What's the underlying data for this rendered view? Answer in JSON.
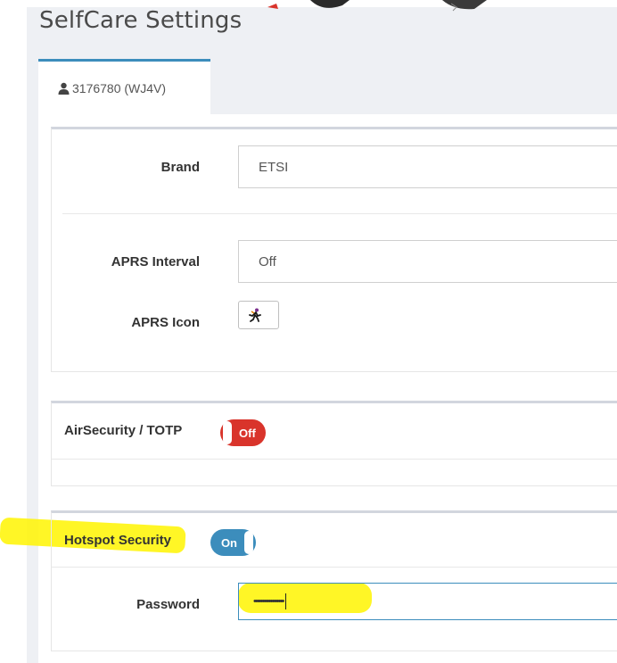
{
  "page": {
    "title": "SelfCare Settings"
  },
  "tab": {
    "icon": "user-icon",
    "label": "3176780 (WJ4V)"
  },
  "general": {
    "brand": {
      "label": "Brand",
      "value": "ETSI"
    },
    "aprs_interval": {
      "label": "APRS Interval",
      "value": "Off"
    },
    "aprs_icon": {
      "label": "APRS Icon",
      "icon": "running-man-icon"
    }
  },
  "airsecurity": {
    "label": "AirSecurity / TOTP",
    "toggle": {
      "state": "Off",
      "color": "#d9342b"
    }
  },
  "hotspot": {
    "label": "Hotspot Security",
    "toggle": {
      "state": "On",
      "color": "#3c8dbc"
    },
    "password": {
      "label": "Password",
      "value": "••••••••••••••••••"
    }
  },
  "colors": {
    "accent": "#3c8dbc",
    "highlight": "#fff500",
    "danger": "#d9342b"
  }
}
